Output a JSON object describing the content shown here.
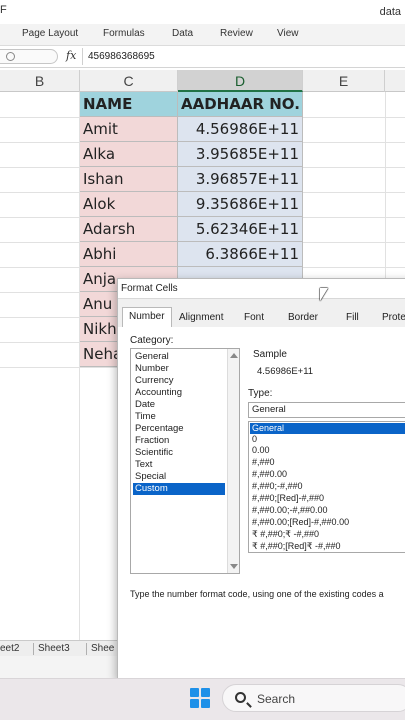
{
  "window": {
    "title_fragment": "data",
    "left_glyph": "F"
  },
  "ribbon": {
    "tabs": [
      "Page Layout",
      "Formulas",
      "Data",
      "Review",
      "View"
    ]
  },
  "formula_bar": {
    "fx": "fx",
    "value": "456986368695"
  },
  "columns": [
    "B",
    "C",
    "D",
    "E"
  ],
  "table": {
    "headers": [
      "NAME",
      "AADHAAR NO."
    ],
    "rows": [
      {
        "name": "Amit",
        "aadhaar": "4.56986E+11"
      },
      {
        "name": "Alka",
        "aadhaar": "3.95685E+11"
      },
      {
        "name": "Ishan",
        "aadhaar": "3.96857E+11"
      },
      {
        "name": "Alok",
        "aadhaar": "9.35686E+11"
      },
      {
        "name": "Adarsh",
        "aadhaar": "5.62346E+11"
      },
      {
        "name": "Abhi",
        "aadhaar": "6.3866E+11"
      },
      {
        "name": "Anja",
        "aadhaar": ""
      },
      {
        "name": "Anu",
        "aadhaar": ""
      },
      {
        "name": "Nikh",
        "aadhaar": ""
      },
      {
        "name": "Neha",
        "aadhaar": ""
      }
    ]
  },
  "sheet_tabs": [
    "eet2",
    "Sheet3",
    "Shee"
  ],
  "dialog": {
    "title": "Format Cells",
    "tabs": [
      "Number",
      "Alignment",
      "Font",
      "Border",
      "Fill",
      "Prote"
    ],
    "active_tab": "Number",
    "category_label": "Category:",
    "categories": [
      "General",
      "Number",
      "Currency",
      "Accounting",
      "Date",
      "Time",
      "Percentage",
      "Fraction",
      "Scientific",
      "Text",
      "Special",
      "Custom"
    ],
    "selected_category": "Custom",
    "sample_label": "Sample",
    "sample_value": "4.56986E+11",
    "type_label": "Type:",
    "type_value": "General",
    "formats": [
      "General",
      "0",
      "0.00",
      "#,##0",
      "#,##0.00",
      "#,##0;-#,##0",
      "#,##0;[Red]-#,##0",
      "#,##0.00;-#,##0.00",
      "#,##0.00;[Red]-#,##0.00",
      "₹ #,##0;₹ -#,##0",
      "₹ #,##0;[Red]₹ -#,##0"
    ],
    "selected_format": "General",
    "hint": "Type the number format code, using one of the existing codes a"
  },
  "taskbar": {
    "search_label": "Search"
  }
}
